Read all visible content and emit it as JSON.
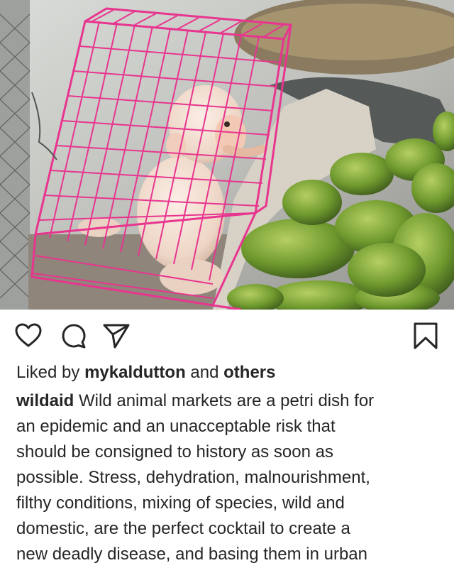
{
  "post": {
    "image_description_icon": "photo-monkey-in-cage",
    "actions": {
      "like_icon": "heart-icon",
      "comment_icon": "comment-icon",
      "share_icon": "send-icon",
      "save_icon": "bookmark-icon"
    },
    "likes": {
      "prefix": "Liked by ",
      "user": "mykaldutton",
      "middle": " and ",
      "suffix": "others"
    },
    "caption": {
      "username": "wildaid",
      "first_line": " Wild animal markets are a petri dish for",
      "lines": [
        "an epidemic and an unacceptable risk that",
        "should be consigned to history as soon as",
        "possible. Stress, dehydration, malnourishment,",
        "filthy conditions, mixing of species, wild and",
        "domestic, are the perfect cocktail to create a",
        "new deadly disease, and basing them in urban"
      ]
    }
  }
}
